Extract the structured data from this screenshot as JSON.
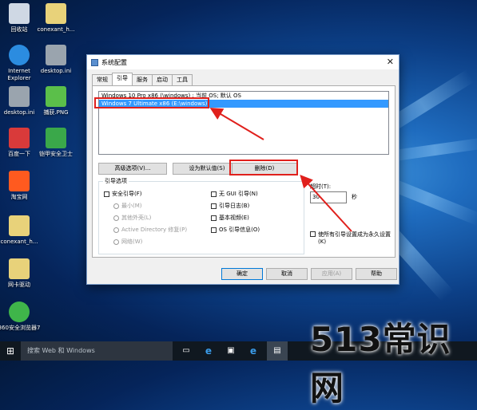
{
  "desktop": {
    "icons": [
      {
        "label": "回收站",
        "icon": "recycle-bin-icon",
        "color": "#cfd8e4"
      },
      {
        "label": "conexant_h...",
        "icon": "file-icon",
        "color": "#e8d27a"
      },
      {
        "label": "Internet Explorer",
        "icon": "ie-icon",
        "color": "#2b8ce0"
      },
      {
        "label": "desktop.ini",
        "icon": "settings-file-icon",
        "color": "#9aa4ae"
      },
      {
        "label": "desktop.ini",
        "icon": "settings-file-icon",
        "color": "#9aa4ae"
      },
      {
        "label": "捕获.PNG",
        "icon": "image-file-icon",
        "color": "#5bbf4a"
      },
      {
        "label": "百度一下",
        "icon": "baidu-icon",
        "color": "#d93a3a"
      },
      {
        "label": "铠甲安全卫士",
        "icon": "shield-icon",
        "color": "#3aa84a"
      },
      {
        "label": "淘宝网",
        "icon": "taobao-icon",
        "color": "#ff5a1f"
      },
      {
        "label": "conexant_h...",
        "icon": "file-icon",
        "color": "#e8d27a"
      },
      {
        "label": "网卡驱动",
        "icon": "file-icon",
        "color": "#e8d27a"
      },
      {
        "label": "360安全浏览器7",
        "icon": "browser-360-icon",
        "color": "#3fb54a"
      }
    ]
  },
  "dialog": {
    "title": "系统配置",
    "close": "✕",
    "tabs": [
      "常规",
      "引导",
      "服务",
      "启动",
      "工具"
    ],
    "os_entries": [
      "Windows 10 Pro x86 (\\windows) : 当前 OS; 默认 OS",
      "Windows 7 Ultimate x86 (E:\\windows)"
    ],
    "buttons": {
      "advanced": "高级选项(V)...",
      "set_default": "设为默认值(S)",
      "delete": "删除(D)"
    },
    "boot_options": {
      "title": "引导选项",
      "safe_boot": "安全引导(F)",
      "minimal": "最小(M)",
      "alternate_shell": "其他外壳(L)",
      "active_directory": "Active Directory 修复(P)",
      "network": "网络(W)",
      "no_gui": "无 GUI 引导(N)",
      "boot_log": "引导日志(B)",
      "base_video": "基本视频(E)",
      "os_boot_info": "OS 引导信息(O)"
    },
    "timeout": {
      "label": "超时(T):",
      "value": "30",
      "unit": "秒"
    },
    "permanent": "使所有引导设置成为永久设置(K)",
    "footer": {
      "ok": "确定",
      "cancel": "取消",
      "apply": "应用(A)",
      "help": "帮助"
    }
  },
  "taskbar": {
    "search_placeholder": "搜索 Web 和 Windows"
  },
  "watermark": "513常识网",
  "annotation_color": "#e0201c"
}
